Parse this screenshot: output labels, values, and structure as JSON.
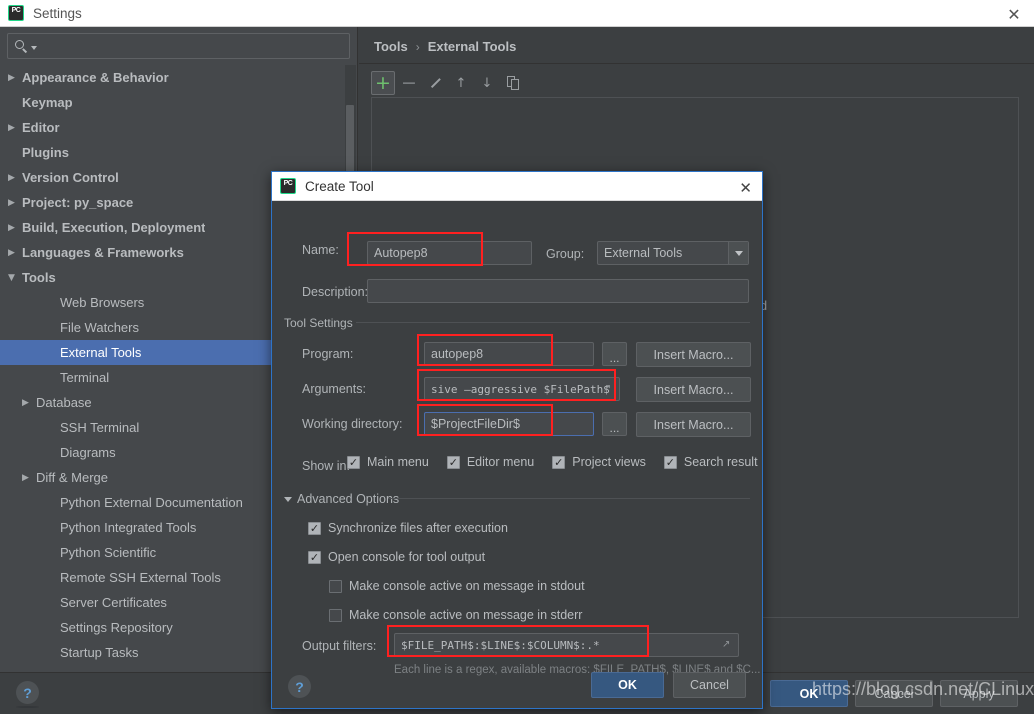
{
  "window": {
    "title": "Settings",
    "logo_text": "PC",
    "close_icon": "✕"
  },
  "sidebar": {
    "search": {
      "placeholder": "",
      "value": "",
      "icon": "search-icon"
    },
    "items": [
      {
        "label": "Appearance & Behavior",
        "level": 0,
        "arrow": "collapsed",
        "selected": false
      },
      {
        "label": "Keymap",
        "level": 0,
        "arrow": "none",
        "selected": false
      },
      {
        "label": "Editor",
        "level": 0,
        "arrow": "collapsed",
        "selected": false
      },
      {
        "label": "Plugins",
        "level": 0,
        "arrow": "none",
        "selected": false
      },
      {
        "label": "Version Control",
        "level": 0,
        "arrow": "collapsed",
        "selected": false
      },
      {
        "label": "Project: py_space",
        "level": 0,
        "arrow": "collapsed",
        "selected": false
      },
      {
        "label": "Build, Execution, Deployment",
        "level": 0,
        "arrow": "collapsed",
        "selected": false
      },
      {
        "label": "Languages & Frameworks",
        "level": 0,
        "arrow": "collapsed",
        "selected": false
      },
      {
        "label": "Tools",
        "level": 0,
        "arrow": "expanded",
        "selected": false
      },
      {
        "label": "Web Browsers",
        "level": 1,
        "arrow": "none",
        "selected": false
      },
      {
        "label": "File Watchers",
        "level": 1,
        "arrow": "none",
        "selected": false
      },
      {
        "label": "External Tools",
        "level": 1,
        "arrow": "none",
        "selected": true
      },
      {
        "label": "Terminal",
        "level": 1,
        "arrow": "none",
        "selected": false
      },
      {
        "label": "Database",
        "level": 1,
        "arrow": "collapsed",
        "selected": false
      },
      {
        "label": "SSH Terminal",
        "level": 1,
        "arrow": "none",
        "selected": false
      },
      {
        "label": "Diagrams",
        "level": 1,
        "arrow": "none",
        "selected": false
      },
      {
        "label": "Diff & Merge",
        "level": 1,
        "arrow": "collapsed",
        "selected": false
      },
      {
        "label": "Python External Documentation",
        "level": 1,
        "arrow": "none",
        "selected": false
      },
      {
        "label": "Python Integrated Tools",
        "level": 1,
        "arrow": "none",
        "selected": false
      },
      {
        "label": "Python Scientific",
        "level": 1,
        "arrow": "none",
        "selected": false
      },
      {
        "label": "Remote SSH External Tools",
        "level": 1,
        "arrow": "none",
        "selected": false
      },
      {
        "label": "Server Certificates",
        "level": 1,
        "arrow": "none",
        "selected": false
      },
      {
        "label": "Settings Repository",
        "level": 1,
        "arrow": "none",
        "selected": false
      },
      {
        "label": "Startup Tasks",
        "level": 1,
        "arrow": "none",
        "selected": false
      }
    ]
  },
  "main": {
    "breadcrumb": {
      "parent": "Tools",
      "separator": "›",
      "current": "External Tools"
    },
    "toolbar": [
      {
        "name": "add",
        "glyph": "+",
        "active": true
      },
      {
        "name": "remove",
        "glyph": "−",
        "active": false
      },
      {
        "name": "edit",
        "glyph": "pencil",
        "active": false
      },
      {
        "name": "move-up",
        "glyph": "↑",
        "active": false
      },
      {
        "name": "move-down",
        "glyph": "↓",
        "active": false
      },
      {
        "name": "copy",
        "glyph": "copy",
        "active": false
      }
    ],
    "obscured_text": "red"
  },
  "settings_footer": {
    "help_glyph": "?",
    "buttons": [
      {
        "label": "OK",
        "primary": true
      },
      {
        "label": "Cancel",
        "primary": false
      },
      {
        "label": "Apply",
        "primary": false
      }
    ]
  },
  "dialog": {
    "title": "Create Tool",
    "logo_text": "PC",
    "close_icon": "✕",
    "name": {
      "label": "Name:",
      "value": "Autopep8",
      "placeholder": ""
    },
    "group": {
      "label": "Group:",
      "value": "External Tools",
      "options": [
        "External Tools"
      ]
    },
    "description": {
      "label": "Description:",
      "value": "",
      "placeholder": ""
    },
    "tool_settings": {
      "legend": "Tool Settings",
      "program": {
        "label": "Program:",
        "value": "autopep8",
        "browse_label": "...",
        "macro_label": "Insert Macro..."
      },
      "arguments": {
        "label": "Arguments:",
        "value": "sive —aggressive $FilePath$",
        "macro_label": "Insert Macro..."
      },
      "working_directory": {
        "label": "Working directory:",
        "value": "$ProjectFileDir$",
        "browse_label": "...",
        "macro_label": "Insert Macro..."
      }
    },
    "show_in": {
      "label": "Show in:",
      "options": [
        {
          "label": "Main menu",
          "checked": true
        },
        {
          "label": "Editor menu",
          "checked": true
        },
        {
          "label": "Project views",
          "checked": true
        },
        {
          "label": "Search result",
          "checked": true
        }
      ]
    },
    "advanced_options": {
      "legend": "Advanced Options",
      "expanded": true,
      "options": [
        {
          "label": "Synchronize files after execution",
          "checked": true
        },
        {
          "label": "Open console for tool output",
          "checked": true
        },
        {
          "label": "Make console active on message in stdout",
          "checked": false
        },
        {
          "label": "Make console active on message in stderr",
          "checked": false
        }
      ],
      "output_filters": {
        "label": "Output filters:",
        "value": "$FILE_PATH$:$LINE$:$COLUMN$:.*",
        "hint": "Each line is a regex, available macros: $FILE_PATH$, $LINE$ and $C..."
      }
    },
    "footer": {
      "help_glyph": "?",
      "ok_label": "OK",
      "cancel_label": "Cancel"
    }
  },
  "annotations": {
    "highlight_color": "#ff2020",
    "watermark": "https://blog.csdn.net/CLinuxF"
  }
}
